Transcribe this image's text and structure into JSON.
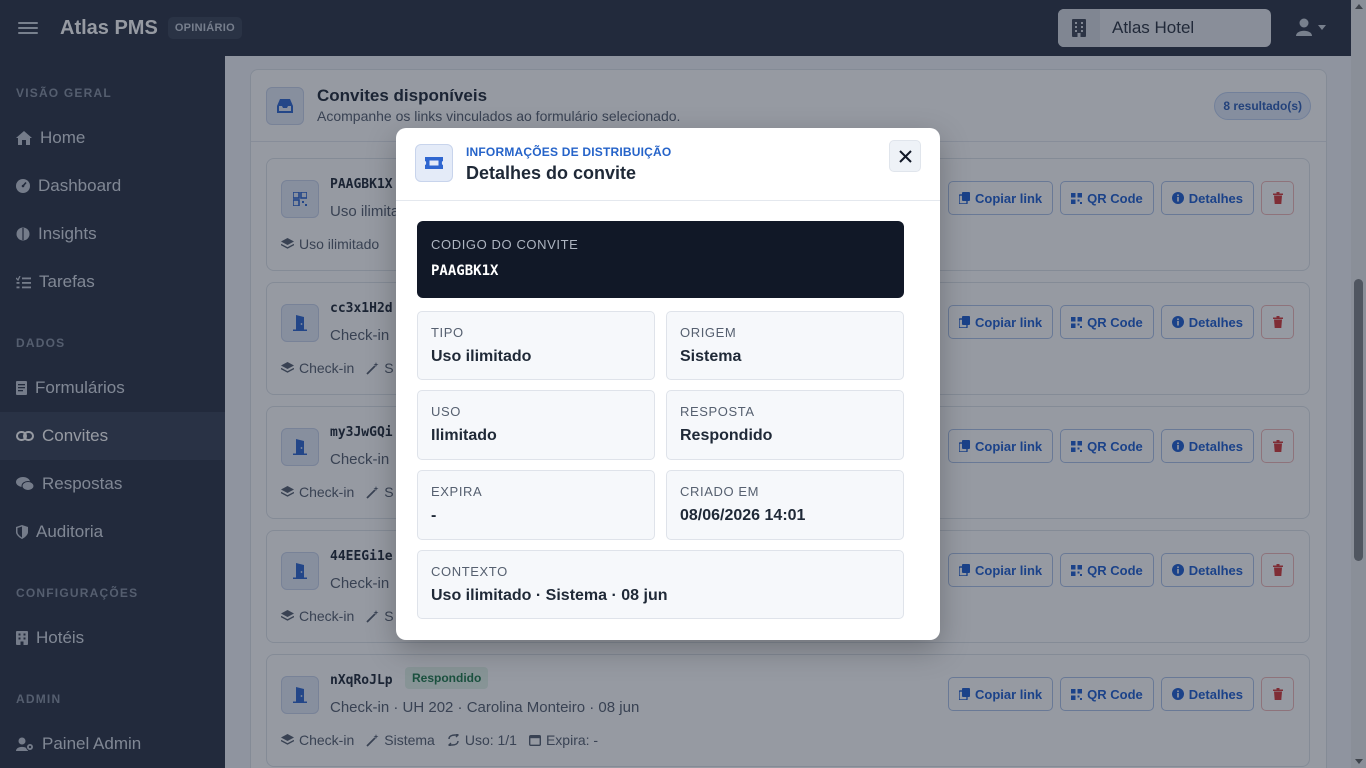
{
  "topbar": {
    "brand": "Atlas PMS",
    "badge": "OPINIÁRIO",
    "hotel": "Atlas Hotel"
  },
  "sidebar": {
    "sections": [
      "VISÃO GERAL",
      "DADOS",
      "CONFIGURAÇÕES",
      "ADMIN"
    ],
    "items": [
      {
        "label": "Home",
        "icon": "home-icon"
      },
      {
        "label": "Dashboard",
        "icon": "gauge-icon"
      },
      {
        "label": "Insights",
        "icon": "brain-icon"
      },
      {
        "label": "Tarefas",
        "icon": "list-check-icon"
      },
      {
        "label": "Formulários",
        "icon": "form-icon"
      },
      {
        "label": "Convites",
        "icon": "link-icon",
        "active": true
      },
      {
        "label": "Respostas",
        "icon": "comments-icon"
      },
      {
        "label": "Auditoria",
        "icon": "shield-icon"
      },
      {
        "label": "Hotéis",
        "icon": "building-icon"
      },
      {
        "label": "Painel Admin",
        "icon": "user-gear-icon"
      }
    ]
  },
  "card": {
    "title": "Convites disponíveis",
    "subtitle": "Acompanhe os links vinculados ao formulário selecionado.",
    "badge": "8 resultado(s)"
  },
  "actions": {
    "copy": "Copiar link",
    "qr": "QR Code",
    "details": "Detalhes"
  },
  "invites": [
    {
      "code": "PAAGBK1X",
      "desc": "Uso ilimita",
      "meta": [
        "Uso ilimitado"
      ]
    },
    {
      "code": "cc3x1H2d",
      "desc": "Check-in",
      "meta": [
        "Check-in",
        "S"
      ]
    },
    {
      "code": "my3JwGQi",
      "desc": "Check-in",
      "meta": [
        "Check-in",
        "S"
      ]
    },
    {
      "code": "44EEGi1e",
      "desc": "Check-in",
      "meta": [
        "Check-in",
        "S"
      ]
    },
    {
      "code": "nXqRoJLp",
      "status": "Respondido",
      "desc": "Check-in · UH 202 · Carolina Monteiro · 08 jun",
      "meta": [
        "Check-in",
        "Sistema",
        "Uso: 1/1",
        "Expira: -"
      ]
    }
  ],
  "modal": {
    "eyebrow": "INFORMAÇÕES DE DISTRIBUIÇÃO",
    "title": "Detalhes do convite",
    "code_label": "CODIGO DO CONVITE",
    "code_value": "PAAGBK1X",
    "fields": {
      "tipo": {
        "label": "TIPO",
        "value": "Uso ilimitado"
      },
      "origem": {
        "label": "ORIGEM",
        "value": "Sistema"
      },
      "uso": {
        "label": "USO",
        "value": "Ilimitado"
      },
      "resposta": {
        "label": "RESPOSTA",
        "value": "Respondido"
      },
      "expira": {
        "label": "EXPIRA",
        "value": "-"
      },
      "criado": {
        "label": "CRIADO EM",
        "value": "08/06/2026 14:01"
      },
      "contexto": {
        "label": "CONTEXTO",
        "value": "Uso ilimitado · Sistema · 08 jun"
      }
    }
  },
  "colors": {
    "accent": "#1f5fd1",
    "danger": "#d63a3a",
    "success": "#1f7a4b",
    "sidebar": "#2c3446"
  }
}
